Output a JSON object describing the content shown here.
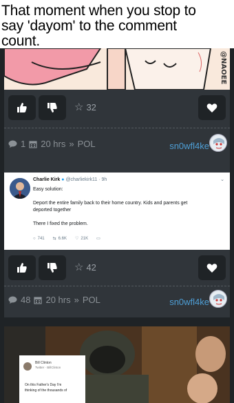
{
  "caption": {
    "line1": "That moment when you stop to",
    "line2": "say 'dayom' to the comment",
    "line3": "count."
  },
  "cartoon": {
    "watermark": "@NAOEE"
  },
  "post1": {
    "star_count": "32",
    "comment_count": "1",
    "time": "20 hrs",
    "board": "POL",
    "username": "sn0wfl4ke"
  },
  "tweet": {
    "name": "Charlie Kirk",
    "handle": "@charliekirk11 · 9h",
    "line1": "Easy solution:",
    "line2": "Deport the entire family back to their home country. Kids and parents get",
    "line3": "deported together",
    "line4": "There I fixed the problem.",
    "replies": "741",
    "retweets": "6.6K",
    "likes": "21K"
  },
  "post2": {
    "star_count": "42",
    "comment_count": "48",
    "time": "20 hrs",
    "board": "POL",
    "username": "sn0wfl4ke"
  },
  "photo_post": {
    "inner_name": "Bill Clinton",
    "inner_handle": "Twitter · BillClinton",
    "inner_text1": "On this Father's Day I'm",
    "inner_text2": "thinking of the thousands of"
  },
  "icons": {
    "like": "thumbs-up-icon",
    "dislike": "thumbs-down-icon",
    "star": "star-icon",
    "favorite": "heart-icon",
    "comment": "comment-icon",
    "calendar": "calendar-icon"
  },
  "colors": {
    "background": "#1f2326",
    "card": "#30353a",
    "username": "#4e9fd6",
    "muted": "#8b9196"
  }
}
